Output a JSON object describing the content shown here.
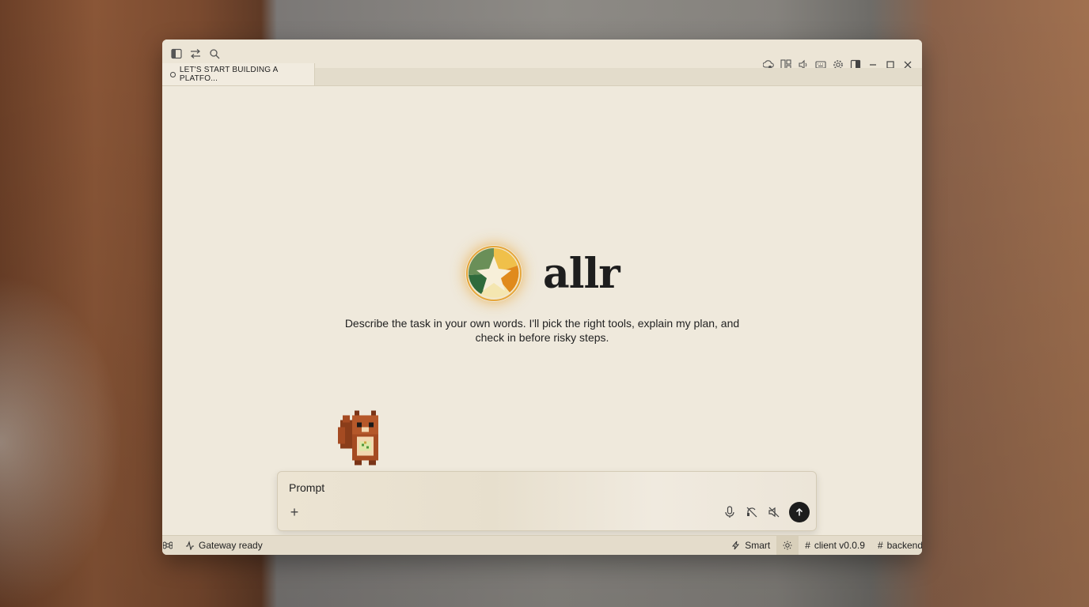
{
  "window": {
    "tab_title": "LET'S START BUILDING A PLATFO..."
  },
  "brand": {
    "name": "allr",
    "tagline": "Describe the task in your own words. I'll pick the right tools, explain my plan, and check in before risky steps.",
    "logo_colors": [
      "#6a8f58",
      "#2f6b3c",
      "#f0c04a",
      "#e08a1c",
      "#f4e6b0"
    ]
  },
  "prompt": {
    "value": "Prompt "
  },
  "statusbar": {
    "gateway": "Gateway ready",
    "mode": "Smart",
    "client": "client v0.0.9",
    "channel": "backend"
  },
  "icons": {
    "titlebar_left": [
      "sidebar-toggle-icon",
      "swap-icon",
      "search-icon"
    ],
    "titlebar_right": [
      "cloud-sync-icon",
      "layout-icon",
      "speaker-icon",
      "keyboard-icon",
      "settings-icon",
      "panel-icon",
      "minimize-icon",
      "maximize-icon",
      "close-icon"
    ],
    "prompt_tools": [
      "microphone-icon",
      "headset-off-icon",
      "volume-off-icon",
      "send-arrow-icon"
    ]
  }
}
